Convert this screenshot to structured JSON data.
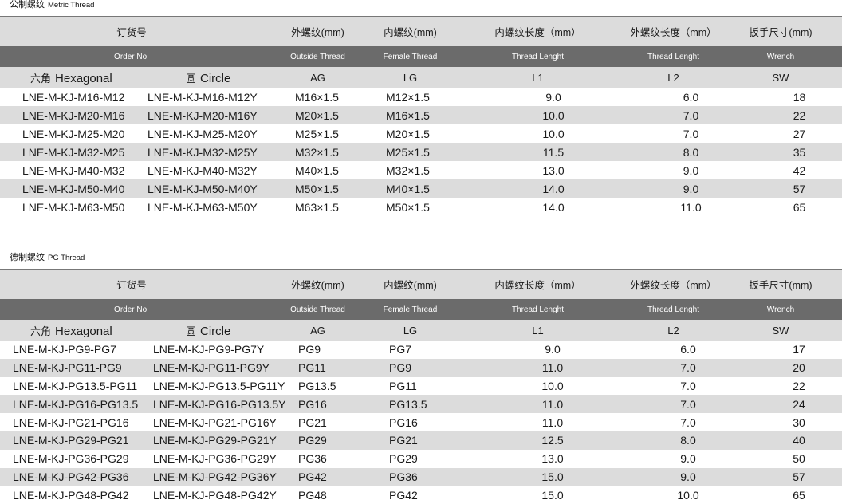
{
  "headers": {
    "order_cn": "订货号",
    "outside_cn": "外螺纹(mm)",
    "inside_cn": "内螺纹(mm)",
    "inner_len_cn": "内螺纹长度（mm）",
    "outer_len_cn": "外螺纹长度（mm）",
    "wrench_cn": "扳手尺寸(mm)",
    "order_en": "Order No.",
    "outside_en": "Outside Thread",
    "inside_en": "Female Thread",
    "inner_len_en": "Thread Lenght",
    "outer_len_en": "Thread Lenght",
    "wrench_en": "Wrench",
    "hex_cn": "六角",
    "hex_en": "Hexagonal",
    "circle_cn": "圆",
    "circle_en": "Circle",
    "ag": "AG",
    "lg": "LG",
    "l1": "L1",
    "l2": "L2",
    "sw": "SW"
  },
  "metric": {
    "title_cn": "公制螺纹",
    "title_en": "Metric Thread",
    "rows": [
      [
        "LNE-M-KJ-M16-M12",
        "LNE-M-KJ-M16-M12Y",
        "M16×1.5",
        "M12×1.5",
        "9.0",
        "6.0",
        "18"
      ],
      [
        "LNE-M-KJ-M20-M16",
        "LNE-M-KJ-M20-M16Y",
        "M20×1.5",
        "M16×1.5",
        "10.0",
        "7.0",
        "22"
      ],
      [
        "LNE-M-KJ-M25-M20",
        "LNE-M-KJ-M25-M20Y",
        "M25×1.5",
        "M20×1.5",
        "10.0",
        "7.0",
        "27"
      ],
      [
        "LNE-M-KJ-M32-M25",
        "LNE-M-KJ-M32-M25Y",
        "M32×1.5",
        "M25×1.5",
        "11.5",
        "8.0",
        "35"
      ],
      [
        "LNE-M-KJ-M40-M32",
        "LNE-M-KJ-M40-M32Y",
        "M40×1.5",
        "M32×1.5",
        "13.0",
        "9.0",
        "42"
      ],
      [
        "LNE-M-KJ-M50-M40",
        "LNE-M-KJ-M50-M40Y",
        "M50×1.5",
        "M40×1.5",
        "14.0",
        "9.0",
        "57"
      ],
      [
        "LNE-M-KJ-M63-M50",
        "LNE-M-KJ-M63-M50Y",
        "M63×1.5",
        "M50×1.5",
        "14.0",
        "11.0",
        "65"
      ]
    ]
  },
  "pg": {
    "title_cn": "德制螺纹",
    "title_en": "PG Thread",
    "rows": [
      [
        "LNE-M-KJ-PG9-PG7",
        "LNE-M-KJ-PG9-PG7Y",
        "PG9",
        "PG7",
        "9.0",
        "6.0",
        "17"
      ],
      [
        "LNE-M-KJ-PG11-PG9",
        "LNE-M-KJ-PG11-PG9Y",
        "PG11",
        "PG9",
        "11.0",
        "7.0",
        "20"
      ],
      [
        "LNE-M-KJ-PG13.5-PG11",
        "LNE-M-KJ-PG13.5-PG11Y",
        "PG13.5",
        "PG11",
        "10.0",
        "7.0",
        "22"
      ],
      [
        "LNE-M-KJ-PG16-PG13.5",
        "LNE-M-KJ-PG16-PG13.5Y",
        "PG16",
        "PG13.5",
        "11.0",
        "7.0",
        "24"
      ],
      [
        "LNE-M-KJ-PG21-PG16",
        "LNE-M-KJ-PG21-PG16Y",
        "PG21",
        "PG16",
        "11.0",
        "7.0",
        "30"
      ],
      [
        "LNE-M-KJ-PG29-PG21",
        "LNE-M-KJ-PG29-PG21Y",
        "PG29",
        "PG21",
        "12.5",
        "8.0",
        "40"
      ],
      [
        "LNE-M-KJ-PG36-PG29",
        "LNE-M-KJ-PG36-PG29Y",
        "PG36",
        "PG29",
        "13.0",
        "9.0",
        "50"
      ],
      [
        "LNE-M-KJ-PG42-PG36",
        "LNE-M-KJ-PG42-PG36Y",
        "PG42",
        "PG36",
        "15.0",
        "9.0",
        "57"
      ],
      [
        "LNE-M-KJ-PG48-PG42",
        "LNE-M-KJ-PG48-PG42Y",
        "PG48",
        "PG42",
        "15.0",
        "10.0",
        "65"
      ]
    ]
  }
}
